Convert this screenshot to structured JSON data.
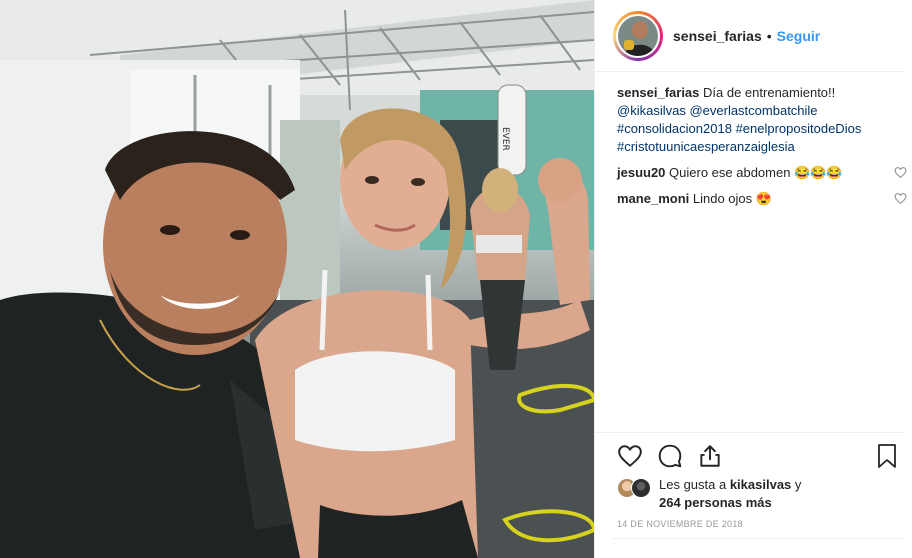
{
  "post": {
    "username": "sensei_farias",
    "dot": "•",
    "follow_label": "Seguir"
  },
  "caption": {
    "username": "sensei_farias",
    "text": " Día de entrenamiento!! ",
    "mentions": [
      "@kikasilvas",
      "@everlastcombatchile"
    ],
    "hashtags": [
      "#consolidacion2018",
      "#enelpropositodeDios",
      "#cristotuunicaesperanzaiglesia"
    ]
  },
  "comments": [
    {
      "username": "jesuu20",
      "text": " Quiero ese abdomen 😂😂😂"
    },
    {
      "username": "mane_moni",
      "text": " Lindo ojos 😍"
    }
  ],
  "likes": {
    "prefix": "Les gusta a ",
    "user": "kikasilvas",
    "mid": " y",
    "count_text": "264 personas más"
  },
  "date": "14 DE NOVIEMBRE DE 2018",
  "icons": {
    "like": "heart-icon",
    "comment": "comment-bubble-icon",
    "share": "share-icon",
    "save": "bookmark-icon"
  },
  "colors": {
    "link": "#003569",
    "follow": "#3897f0",
    "text": "#262626",
    "muted": "#999999"
  }
}
